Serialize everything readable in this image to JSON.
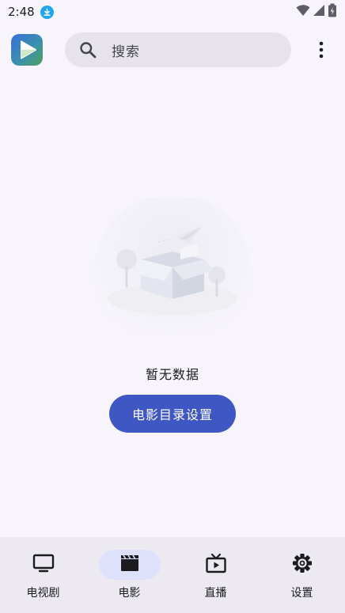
{
  "status_bar": {
    "time": "2:48",
    "icons": [
      "download-icon",
      "wifi-icon",
      "signal-icon",
      "battery-icon"
    ]
  },
  "app_bar": {
    "logo_icon": "play-logo-icon",
    "search": {
      "placeholder": "搜索",
      "icon": "search-icon"
    },
    "menu_icon": "more-vert-icon"
  },
  "empty_state": {
    "message": "暂无数据",
    "button_label": "电影目录设置"
  },
  "bottom_nav": {
    "items": [
      {
        "label": "电视剧",
        "icon": "tv-icon",
        "active": false
      },
      {
        "label": "电影",
        "icon": "clapperboard-icon",
        "active": true
      },
      {
        "label": "直播",
        "icon": "live-tv-icon",
        "active": false
      },
      {
        "label": "设置",
        "icon": "gear-icon",
        "active": false
      }
    ]
  },
  "colors": {
    "background": "#f7f5fb",
    "search_bg": "#e6e3eb",
    "primary": "#3f57c3",
    "nav_bg": "#ece9f1",
    "nav_active_pill": "#dde1fb",
    "download_badge": "#1ea7f1"
  }
}
